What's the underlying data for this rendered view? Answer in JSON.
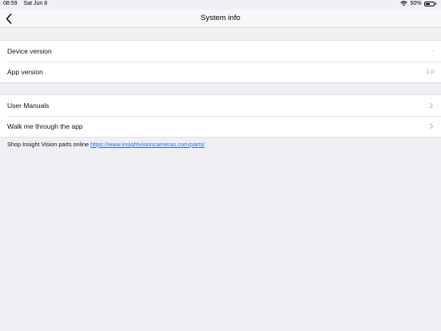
{
  "status_bar": {
    "time": "08:59",
    "date": "Sat Jun 8",
    "battery": "50%",
    "battery_level": 0.5
  },
  "nav": {
    "title": "System info",
    "back_icon": "chevron-left-icon"
  },
  "version_group": {
    "device_label": "Device version",
    "device_value": "-",
    "app_label": "App version",
    "app_value": "1.0"
  },
  "help_group": {
    "manuals_label": "User Manuals",
    "walkthrough_label": "Walk me through the app"
  },
  "footer": {
    "text": "Shop Insight Vision parts online",
    "link": "https://www.insightvisioncameras.com/parts/"
  },
  "colors": {
    "background": "#f0eff4",
    "link": "#2a6fd6",
    "secondary_text": "#9a9aa0"
  }
}
